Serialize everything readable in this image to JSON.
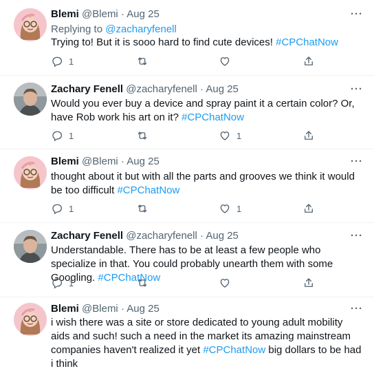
{
  "tweets": [
    {
      "author": "Blemi",
      "handle": "@Blemi",
      "date": "Aug 25",
      "replying_prefix": "Replying to ",
      "replying_to": "@zacharyfenell",
      "text_parts": [
        "Trying to! But it is sooo hard to find cute devices! ",
        "#CPChatNow",
        ""
      ],
      "reply_count": "1",
      "like_count": ""
    },
    {
      "author": "Zachary Fenell",
      "handle": "@zacharyfenell",
      "date": "Aug 25",
      "text_parts": [
        "Would you ever buy a device and spray paint it a certain color? Or, have Rob work his art on it? ",
        "#CPChatNow",
        ""
      ],
      "reply_count": "1",
      "like_count": "1"
    },
    {
      "author": "Blemi",
      "handle": "@Blemi",
      "date": "Aug 25",
      "text_parts": [
        "thought about it but with all the parts and grooves we think it would be too difficult ",
        "#CPChatNow",
        ""
      ],
      "reply_count": "1",
      "like_count": "1"
    },
    {
      "author": "Zachary Fenell",
      "handle": "@zacharyfenell",
      "date": "Aug 25",
      "text_parts": [
        "Understandable. There has to be at least a few people who specialize in that. You could probably unearth them with some Googling. ",
        "#CPChatNow",
        ""
      ],
      "reply_count": "1",
      "like_count": ""
    },
    {
      "author": "Blemi",
      "handle": "@Blemi",
      "date": "Aug 25",
      "text_parts": [
        "i wish there was a site or store dedicated to young adult mobility aids and such! such a need in the market its amazing mainstream companies haven't realized it yet ",
        "#CPChatNow",
        " big dollars to be had i think"
      ],
      "reply_count": "",
      "like_count": ""
    }
  ],
  "icons": {
    "reply": "reply-icon",
    "retweet": "retweet-icon",
    "like": "like-icon",
    "share": "share-icon",
    "more": "more-icon"
  },
  "separator": "·",
  "more_glyph": "···",
  "colors": {
    "link": "#1d9bf0",
    "muted": "#536471",
    "text": "#0f1419"
  }
}
